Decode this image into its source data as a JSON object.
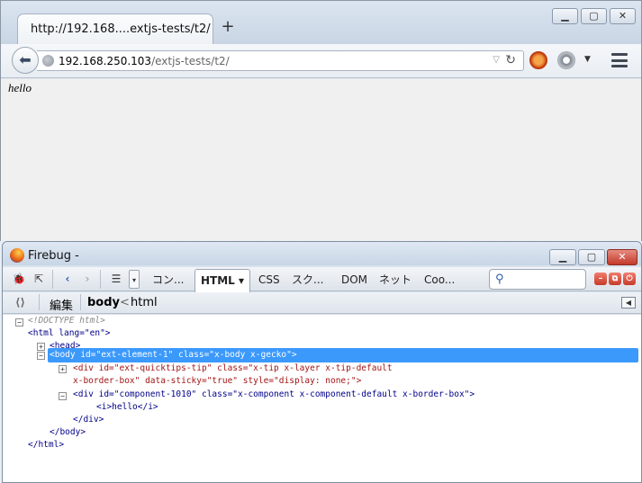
{
  "browser": {
    "tab_title": "http://192.168....extjs-tests/t2/",
    "newtab_icon": "+",
    "url_host": "192.168.250.103",
    "url_path": "/extjs-tests/t2/",
    "page_text": "hello"
  },
  "firebug": {
    "title": "Firebug -",
    "tabs": [
      "コン...",
      "HTML ▾",
      "CSS",
      "スク...",
      "DOM",
      "ネット",
      "Coo..."
    ],
    "active_tab": "HTML",
    "edit_label": "編集",
    "breadcrumb": {
      "current": "body",
      "separator": "<",
      "parent": "html"
    },
    "html_lines": [
      "<!DOCTYPE html>",
      "<html lang=\"en\">",
      "<head>",
      "<body id=\"ext-element-1\" class=\"x-body x-gecko\">",
      "<div id=\"ext-quicktips-tip\" class=\"x-tip x-layer x-tip-default",
      "x-border-box\" data-sticky=\"true\" style=\"display: none;\">",
      "<div id=\"component-1010\" class=\"x-component x-component-default x-border-box\">",
      "<i>hello</i>",
      "</div>",
      "</body>",
      "</html>"
    ]
  },
  "colors": {
    "selection": "#3b99fc",
    "tag": "#000088",
    "attr_value": "#a31515"
  }
}
